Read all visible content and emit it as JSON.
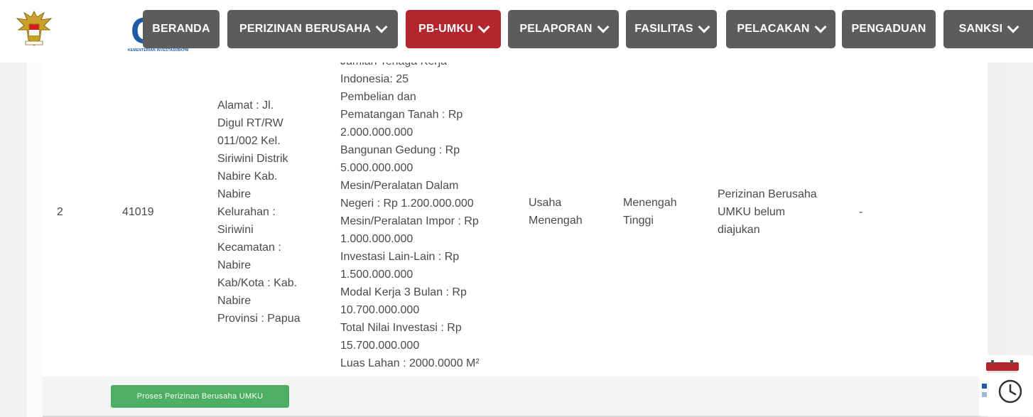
{
  "header": {
    "logo_text": "OSS",
    "logo_subtitle": "KEMENTERIAN INVESTASI/BKPM",
    "nav": [
      {
        "label": "BERANDA",
        "has_dropdown": false,
        "active": false
      },
      {
        "label": "PERIZINAN BERUSAHA",
        "has_dropdown": true,
        "active": false
      },
      {
        "label": "PB-UMKU",
        "has_dropdown": true,
        "active": true
      },
      {
        "label": "PELAPORAN",
        "has_dropdown": true,
        "active": false
      },
      {
        "label": "FASILITAS",
        "has_dropdown": true,
        "active": false
      },
      {
        "label": "PELACAKAN",
        "has_dropdown": true,
        "active": false
      },
      {
        "label": "PENGADUAN",
        "has_dropdown": false,
        "active": false
      },
      {
        "label": "SANKSI",
        "has_dropdown": true,
        "active": false
      }
    ]
  },
  "row": {
    "number": "2",
    "kbli": "41019",
    "address_lines": [
      "Alamat : Jl.",
      "Digul RT/RW",
      "011/002 Kel.",
      "Siriwini Distrik",
      "Nabire Kab.",
      "Nabire",
      "Kelurahan :",
      "Siriwini",
      "Kecamatan :",
      "Nabire",
      "Kab/Kota : Kab.",
      "Nabire",
      "Provinsi : Papua"
    ],
    "investment_partial_line": "Jumlah Tenaga Kerja",
    "investment_lines": [
      "Indonesia: 25",
      "Pembelian dan",
      "Pematangan Tanah : Rp",
      "2.000.000.000",
      "Bangunan Gedung : Rp",
      "5.000.000.000",
      "Mesin/Peralatan Dalam",
      "Negeri : Rp 1.200.000.000",
      "Mesin/Peralatan Impor : Rp",
      "1.000.000.000",
      "Investasi Lain-Lain : Rp",
      "1.500.000.000",
      "Modal Kerja 3 Bulan : Rp",
      "10.700.000.000",
      "Total Nilai Investasi : Rp",
      "15.700.000.000",
      "Luas Lahan : 2000.0000 M²"
    ],
    "scale_lines": [
      "Usaha",
      "Menengah"
    ],
    "risk_lines": [
      "Menengah",
      "Tinggi"
    ],
    "status_lines": [
      "Perizinan Berusaha",
      "UMKU belum",
      "diajukan"
    ],
    "extra": "-"
  },
  "action_button_label": "Proses Perizinan Berusaha UMKU",
  "colors": {
    "nav_bg": "#5c5c5c",
    "nav_active_bg": "#b3262e",
    "brand_blue": "#1e5aa8",
    "action_green": "#4caf63"
  },
  "icons": {
    "calendar_widget": "calendar-clock-icon",
    "dropdown": "chevron-down-icon"
  }
}
